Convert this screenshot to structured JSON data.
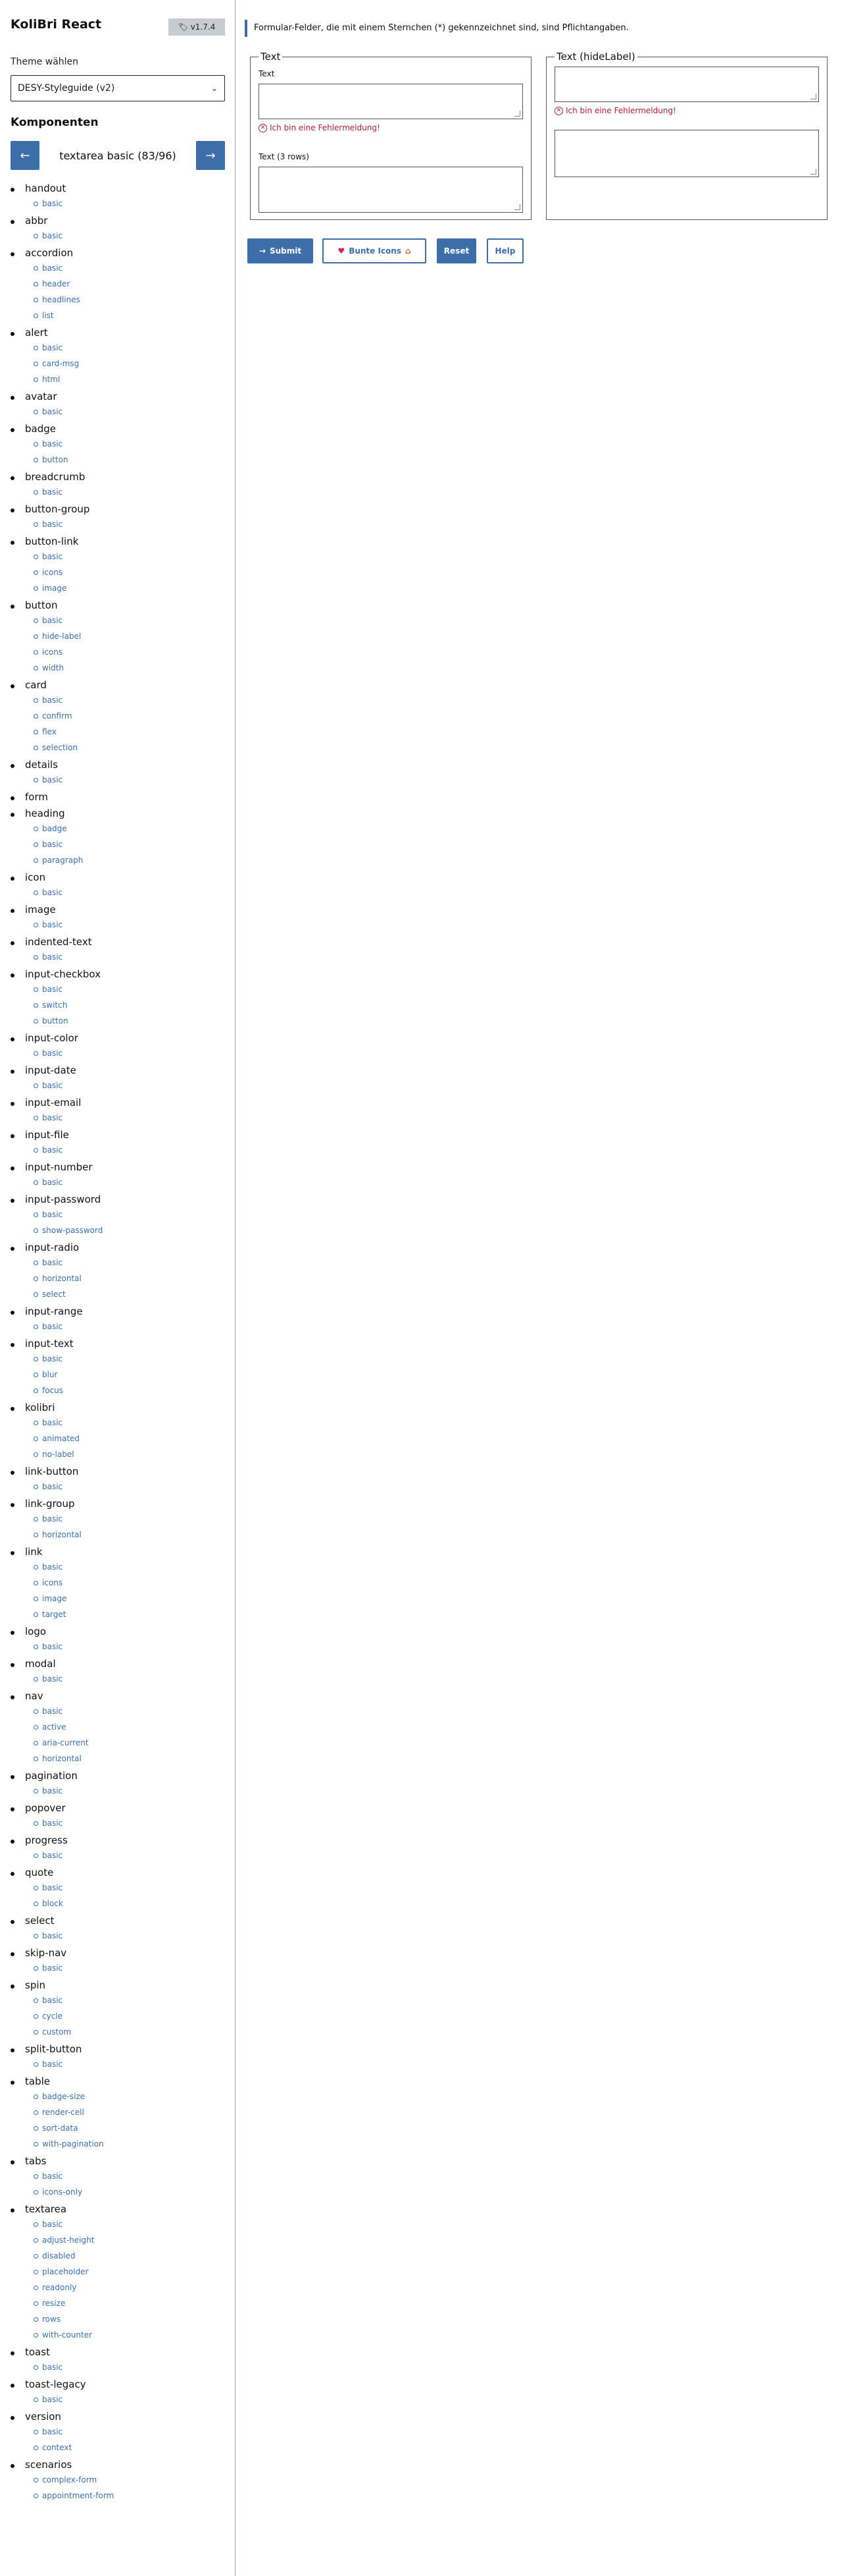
{
  "app": {
    "title": "KoliBri React",
    "version": "v1.7.4",
    "theme_label": "Theme wählen",
    "theme_value": "DESY-Styleguide (v2)",
    "components_heading": "Komponenten",
    "current": "textarea basic (83/96)"
  },
  "colors": {
    "accent": "#3e6eaa",
    "link": "#3a6fb4",
    "error": "#b3202f"
  },
  "nav_icons": {
    "prev": "arrow-left-icon",
    "next": "arrow-right-icon"
  },
  "tree": [
    {
      "name": "handout",
      "items": [
        "basic"
      ]
    },
    {
      "name": "abbr",
      "items": [
        "basic"
      ]
    },
    {
      "name": "accordion",
      "items": [
        "basic",
        "header",
        "headlines",
        "list"
      ]
    },
    {
      "name": "alert",
      "items": [
        "basic",
        "card-msg",
        "html"
      ]
    },
    {
      "name": "avatar",
      "items": [
        "basic"
      ]
    },
    {
      "name": "badge",
      "items": [
        "basic",
        "button"
      ]
    },
    {
      "name": "breadcrumb",
      "items": [
        "basic"
      ]
    },
    {
      "name": "button-group",
      "items": [
        "basic"
      ]
    },
    {
      "name": "button-link",
      "items": [
        "basic",
        "icons",
        "image"
      ]
    },
    {
      "name": "button",
      "items": [
        "basic",
        "hide-label",
        "icons",
        "width"
      ]
    },
    {
      "name": "card",
      "items": [
        "basic",
        "confirm",
        "flex",
        "selection"
      ]
    },
    {
      "name": "details",
      "items": [
        "basic"
      ]
    },
    {
      "name": "form",
      "items": []
    },
    {
      "name": "heading",
      "items": [
        "badge",
        "basic",
        "paragraph"
      ]
    },
    {
      "name": "icon",
      "items": [
        "basic"
      ]
    },
    {
      "name": "image",
      "items": [
        "basic"
      ]
    },
    {
      "name": "indented-text",
      "items": [
        "basic"
      ]
    },
    {
      "name": "input-checkbox",
      "items": [
        "basic",
        "switch",
        "button"
      ]
    },
    {
      "name": "input-color",
      "items": [
        "basic"
      ]
    },
    {
      "name": "input-date",
      "items": [
        "basic"
      ]
    },
    {
      "name": "input-email",
      "items": [
        "basic"
      ]
    },
    {
      "name": "input-file",
      "items": [
        "basic"
      ]
    },
    {
      "name": "input-number",
      "items": [
        "basic"
      ]
    },
    {
      "name": "input-password",
      "items": [
        "basic",
        "show-password"
      ]
    },
    {
      "name": "input-radio",
      "items": [
        "basic",
        "horizontal",
        "select"
      ]
    },
    {
      "name": "input-range",
      "items": [
        "basic"
      ]
    },
    {
      "name": "input-text",
      "items": [
        "basic",
        "blur",
        "focus"
      ]
    },
    {
      "name": "kolibri",
      "items": [
        "basic",
        "animated",
        "no-label"
      ]
    },
    {
      "name": "link-button",
      "items": [
        "basic"
      ]
    },
    {
      "name": "link-group",
      "items": [
        "basic",
        "horizontal"
      ]
    },
    {
      "name": "link",
      "items": [
        "basic",
        "icons",
        "image",
        "target"
      ]
    },
    {
      "name": "logo",
      "items": [
        "basic"
      ]
    },
    {
      "name": "modal",
      "items": [
        "basic"
      ]
    },
    {
      "name": "nav",
      "items": [
        "basic",
        "active",
        "aria-current",
        "horizontal"
      ]
    },
    {
      "name": "pagination",
      "items": [
        "basic"
      ]
    },
    {
      "name": "popover",
      "items": [
        "basic"
      ]
    },
    {
      "name": "progress",
      "items": [
        "basic"
      ]
    },
    {
      "name": "quote",
      "items": [
        "basic",
        "block"
      ]
    },
    {
      "name": "select",
      "items": [
        "basic"
      ]
    },
    {
      "name": "skip-nav",
      "items": [
        "basic"
      ]
    },
    {
      "name": "spin",
      "items": [
        "basic",
        "cycle",
        "custom"
      ]
    },
    {
      "name": "split-button",
      "items": [
        "basic"
      ]
    },
    {
      "name": "table",
      "items": [
        "badge-size",
        "render-cell",
        "sort-data",
        "with-pagination"
      ]
    },
    {
      "name": "tabs",
      "items": [
        "basic",
        "icons-only"
      ]
    },
    {
      "name": "textarea",
      "items": [
        "basic",
        "adjust-height",
        "disabled",
        "placeholder",
        "readonly",
        "resize",
        "rows",
        "with-counter"
      ]
    },
    {
      "name": "toast",
      "items": [
        "basic"
      ]
    },
    {
      "name": "toast-legacy",
      "items": [
        "basic"
      ]
    },
    {
      "name": "version",
      "items": [
        "basic",
        "context"
      ]
    },
    {
      "name": "scenarios",
      "items": [
        "complex-form",
        "appointment-form"
      ]
    }
  ],
  "main": {
    "note": "Formular-Felder, die mit einem Sternchen (*) gekennzeichnet sind, sind Pflichtangaben.",
    "fieldset1": {
      "legend": "Text",
      "field1_label": "Text",
      "error": "Ich bin eine Fehlermeldung!",
      "field2_label": "Text (3 rows)"
    },
    "fieldset2": {
      "legend": "Text (hideLabel)",
      "error": "Ich bin eine Fehlermeldung!"
    },
    "buttons": {
      "submit": "Submit",
      "icons": "Bunte Icons",
      "reset": "Reset",
      "help": "Help"
    }
  }
}
